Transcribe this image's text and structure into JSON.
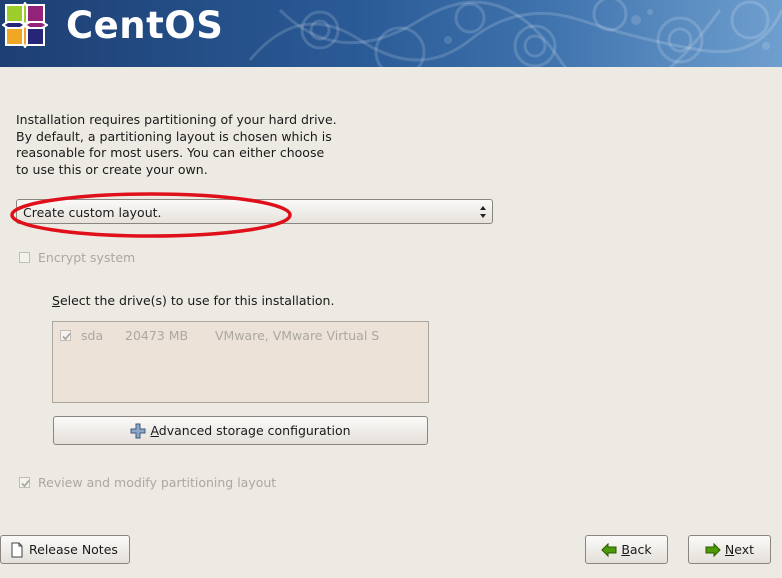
{
  "header": {
    "brand": "CentOS",
    "colors": {
      "banner_dark": "#1d3f73",
      "banner_light": "#6f9fcf"
    }
  },
  "intro": {
    "lines": [
      "Installation requires partitioning of your hard drive.",
      "By default, a partitioning layout is chosen which is",
      "reasonable for most users.  You can either choose",
      "to use this or create your own."
    ]
  },
  "layout_select": {
    "selected": "Create custom layout.",
    "annotation_color": "#e0101a"
  },
  "encrypt": {
    "label": "Encrypt system",
    "checked": false,
    "enabled": false
  },
  "drives": {
    "label_mnemonic": "S",
    "label_rest": "elect the drive(s) to use for this installation.",
    "rows": [
      {
        "checked": true,
        "name": "sda",
        "size": "20473 MB",
        "model": "VMware, VMware Virtual S"
      }
    ]
  },
  "advanced_storage": {
    "icon": "plus-icon",
    "label_mnemonic": "A",
    "label_rest": "dvanced storage configuration"
  },
  "review": {
    "label": "Review and modify partitioning layout",
    "checked": true,
    "enabled": false
  },
  "footer": {
    "release_notes": {
      "icon": "document-icon",
      "label": "Release Notes"
    },
    "back": {
      "icon": "back-arrow-icon",
      "label_mnemonic": "B",
      "label_rest": "ack"
    },
    "next": {
      "icon": "next-arrow-icon",
      "label_mnemonic": "N",
      "label_rest": "ext"
    }
  }
}
